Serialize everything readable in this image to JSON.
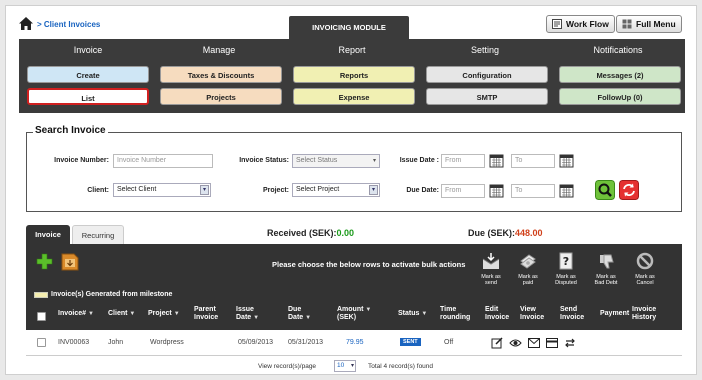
{
  "header": {
    "breadcrumb": "> Client Invoices",
    "module_tab": "INVOICING MODULE",
    "workflow_label": "Work Flow",
    "fullmenu_label": "Full Menu"
  },
  "nav": {
    "columns": [
      {
        "heading": "Invoice",
        "top": "Create",
        "bottom": "List"
      },
      {
        "heading": "Manage",
        "top": "Taxes & Discounts",
        "bottom": "Projects"
      },
      {
        "heading": "Report",
        "top": "Reports",
        "bottom": "Expense"
      },
      {
        "heading": "Setting",
        "top": "Configuration",
        "bottom": "SMTP"
      },
      {
        "heading": "Notifications",
        "top": "Messages (2)",
        "bottom": "FollowUp (0)"
      }
    ]
  },
  "search": {
    "title": "Search Invoice",
    "invoice_number_label": "Invoice Number:",
    "invoice_number_placeholder": "Invoice Number",
    "invoice_status_label": "Invoice Status:",
    "invoice_status_value": "Select Status",
    "issue_date_label": "Issue Date :",
    "due_date_label": "Due Date:",
    "from_placeholder": "From",
    "to_placeholder": "To",
    "client_label": "Client:",
    "client_value": "Select Client",
    "project_label": "Project:",
    "project_value": "Select Project"
  },
  "tabs": {
    "invoice": "Invoice",
    "recurring": "Recurring"
  },
  "summary": {
    "received_label": "Received (SEK):",
    "received_value": "0.00",
    "due_label": "Due (SEK):",
    "due_value": "448.00"
  },
  "bulk": {
    "message": "Please choose the below rows to activate bulk actions",
    "actions": [
      {
        "line1": "Mark as",
        "line2": "send"
      },
      {
        "line1": "Mark as",
        "line2": "paid"
      },
      {
        "line1": "Mark as",
        "line2": "Disputed"
      },
      {
        "line1": "Mark as",
        "line2": "Bad Debt"
      },
      {
        "line1": "Mark as",
        "line2": "Cancel"
      }
    ]
  },
  "milestone_legend": "Invoice(s) Generated from milestone",
  "table": {
    "headers": [
      {
        "l1": "Invoice#",
        "l2": ""
      },
      {
        "l1": "Client",
        "l2": ""
      },
      {
        "l1": "Project",
        "l2": ""
      },
      {
        "l1": "Parent",
        "l2": "Invoice"
      },
      {
        "l1": "Issue",
        "l2": "Date"
      },
      {
        "l1": "Due",
        "l2": "Date"
      },
      {
        "l1": "Amount",
        "l2": "(SEK)"
      },
      {
        "l1": "Status",
        "l2": ""
      },
      {
        "l1": "Time",
        "l2": "rounding"
      },
      {
        "l1": "Edit",
        "l2": "Invoice"
      },
      {
        "l1": "View",
        "l2": "Invoice"
      },
      {
        "l1": "Send",
        "l2": "Invoice"
      },
      {
        "l1": "Payment",
        "l2": ""
      },
      {
        "l1": "Invoice",
        "l2": "History"
      }
    ],
    "rows": [
      {
        "invoice": "INV00063",
        "client": "John",
        "project": "Wordpress",
        "parent": "",
        "issue_date": "05/09/2013",
        "due_date": "05/31/2013",
        "amount": "79.95",
        "status": "SENT",
        "time_rounding": "Off"
      }
    ]
  },
  "pager": {
    "view_label": "View record(s)/page",
    "page_size": "10",
    "total_label": "Total 4 record(s) found"
  },
  "colors": {
    "nav_bg": "#3b3b3b",
    "link_blue": "#1a64c0",
    "received_green": "#1a9a1a",
    "due_red": "#d0401a"
  }
}
